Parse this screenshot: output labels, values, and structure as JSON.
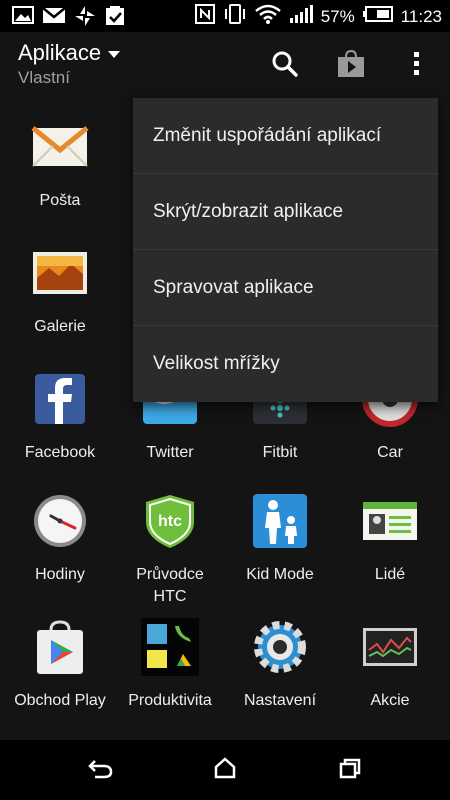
{
  "status_bar": {
    "battery_percent": "57%",
    "time": "11:23",
    "left_icons": [
      "gallery-icon",
      "gmail-icon",
      "network-transfer-icon",
      "task-check-icon"
    ],
    "right_icons": [
      "nfc-icon",
      "vibrate-icon",
      "wifi-icon",
      "signal-icon",
      "battery-icon"
    ]
  },
  "header": {
    "title": "Aplikace",
    "subtitle": "Vlastní",
    "actions": [
      "search-icon",
      "store-icon",
      "overflow-menu-icon"
    ]
  },
  "apps": [
    {
      "label": "Pošta",
      "icon": "mail-icon"
    },
    {
      "label": "Galerie",
      "icon": "gallery-icon"
    },
    {
      "label": "Facebook",
      "icon": "facebook-icon"
    },
    {
      "label": "Twitter",
      "icon": "twitter-icon"
    },
    {
      "label": "Fitbit",
      "icon": "fitbit-icon"
    },
    {
      "label": "Car",
      "icon": "car-icon"
    },
    {
      "label": "Hodiny",
      "icon": "clock-icon"
    },
    {
      "label": "Průvodce HTC",
      "icon": "htc-guide-icon"
    },
    {
      "label": "Kid Mode",
      "icon": "kid-mode-icon"
    },
    {
      "label": "Lidé",
      "icon": "people-icon"
    },
    {
      "label": "Obchod Play",
      "icon": "play-store-icon"
    },
    {
      "label": "Produktivita",
      "icon": "productivity-folder-icon"
    },
    {
      "label": "Nastavení",
      "icon": "settings-gear-icon"
    },
    {
      "label": "Akcie",
      "icon": "stocks-icon"
    }
  ],
  "htc_badge_text": "htc",
  "menu": {
    "items": [
      "Změnit uspořádání aplikací",
      "Skrýt/zobrazit aplikace",
      "Spravovat aplikace",
      "Velikost mřížky"
    ]
  },
  "nav_bar": {
    "buttons": [
      "back-icon",
      "home-icon",
      "recent-apps-icon"
    ]
  },
  "colors": {
    "background": "#141414",
    "menu_background": "#2b2b2b",
    "status_bar": "#000000",
    "subtitle": "#a0a0a0"
  }
}
